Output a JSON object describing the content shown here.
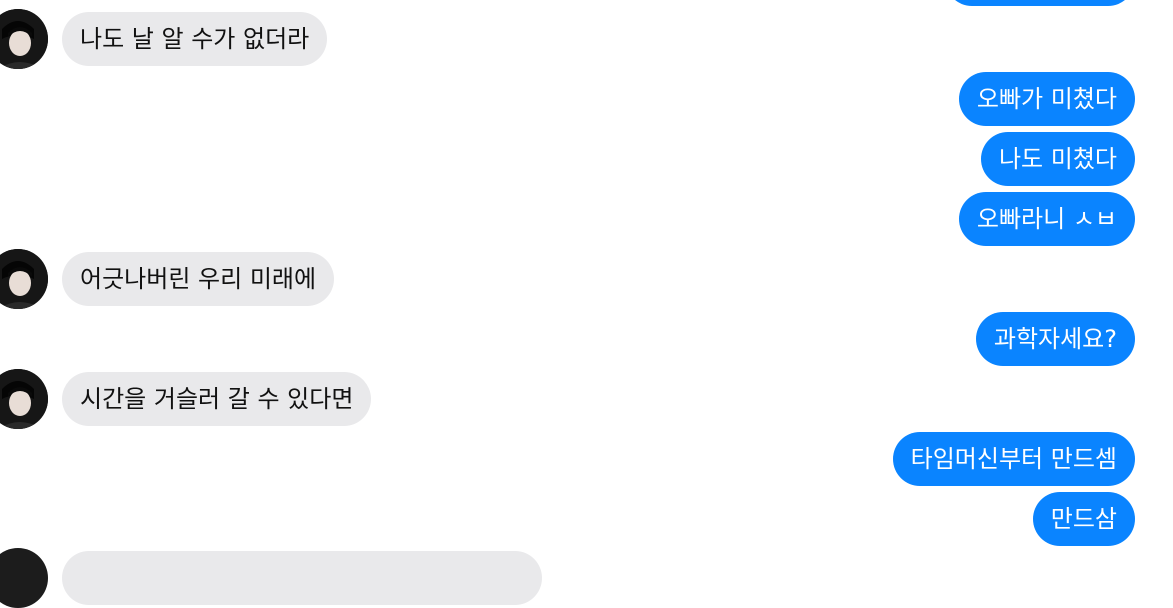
{
  "conversation": {
    "messages": [
      {
        "sender": "other",
        "text": "나도 날 알 수가 없더라"
      },
      {
        "sender": "me",
        "text": "오빠가 미쳤다"
      },
      {
        "sender": "me",
        "text": "나도 미쳤다"
      },
      {
        "sender": "me",
        "text": "오빠라니 ㅅㅂ"
      },
      {
        "sender": "other",
        "text": "어긋나버린 우리 미래에"
      },
      {
        "sender": "me",
        "text": "과학자세요?"
      },
      {
        "sender": "other",
        "text": "시간을 거슬러 갈 수 있다면"
      },
      {
        "sender": "me",
        "text": "타임머신부터 만드셈"
      },
      {
        "sender": "me",
        "text": "만드삼"
      }
    ]
  },
  "colors": {
    "outgoing_bubble": "#0a84ff",
    "incoming_bubble": "#e9e9eb",
    "background": "#ffffff"
  },
  "icons": {
    "avatar": "profile-photo-avatar"
  }
}
